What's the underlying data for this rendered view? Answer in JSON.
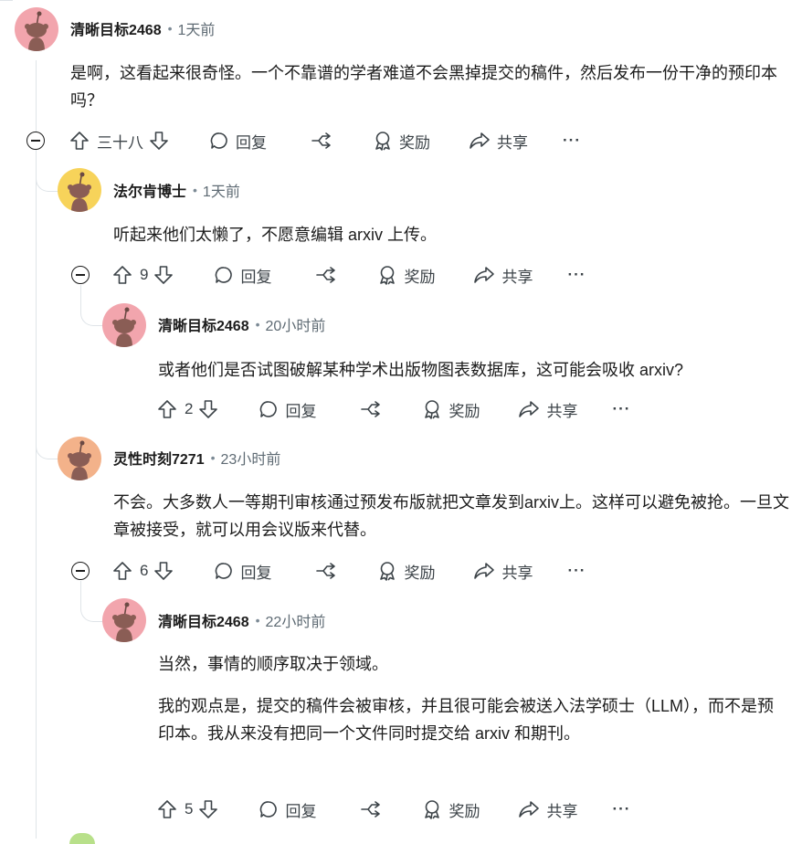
{
  "comments": [
    {
      "author": "清晰目标2468",
      "time": "1天前",
      "text": [
        "是啊，这看起来很奇怪。一个不靠谱的学者难道不会黑掉提交的稿件，然后发布一份干净的预印本吗？"
      ],
      "score": "三十八",
      "avatar_color": "#f2a5ad"
    },
    {
      "author": "法尔肯博士",
      "time": "1天前",
      "text": [
        "听起来他们太懒了，不愿意编辑 arxiv 上传。"
      ],
      "score": "9",
      "avatar_color": "#f7d35a"
    },
    {
      "author": "清晰目标2468",
      "time": "20小时前",
      "text": [
        "或者他们是否试图破解某种学术出版物图表数据库，这可能会吸收 arxiv?"
      ],
      "score": "2",
      "avatar_color": "#f2a5ad"
    },
    {
      "author": "灵性时刻7271",
      "time": "23小时前",
      "text": [
        "不会。大多数人一等期刊审核通过预发布版就把文章发到arxiv上。这样可以避免被抢。一旦文章被接受，就可以用会议版来代替。"
      ],
      "score": "6",
      "avatar_color": "#f3b28a"
    },
    {
      "author": "清晰目标2468",
      "time": "22小时前",
      "text": [
        "当然，事情的顺序取决于领域。",
        "我的观点是，提交的稿件会被审核，并且很可能会被送入法学硕士（LLM），而不是预印本。我从来没有把同一个文件同时提交给 arxiv 和期刊。"
      ],
      "score": "5",
      "avatar_color": "#f2a5ad"
    }
  ],
  "actions": {
    "reply": "回复",
    "award": "奖励",
    "share": "共享",
    "more": "···"
  },
  "colors": {
    "thread_line": "#dfe4e8",
    "text": "#1c1c1c",
    "meta": "#5f6b74"
  }
}
